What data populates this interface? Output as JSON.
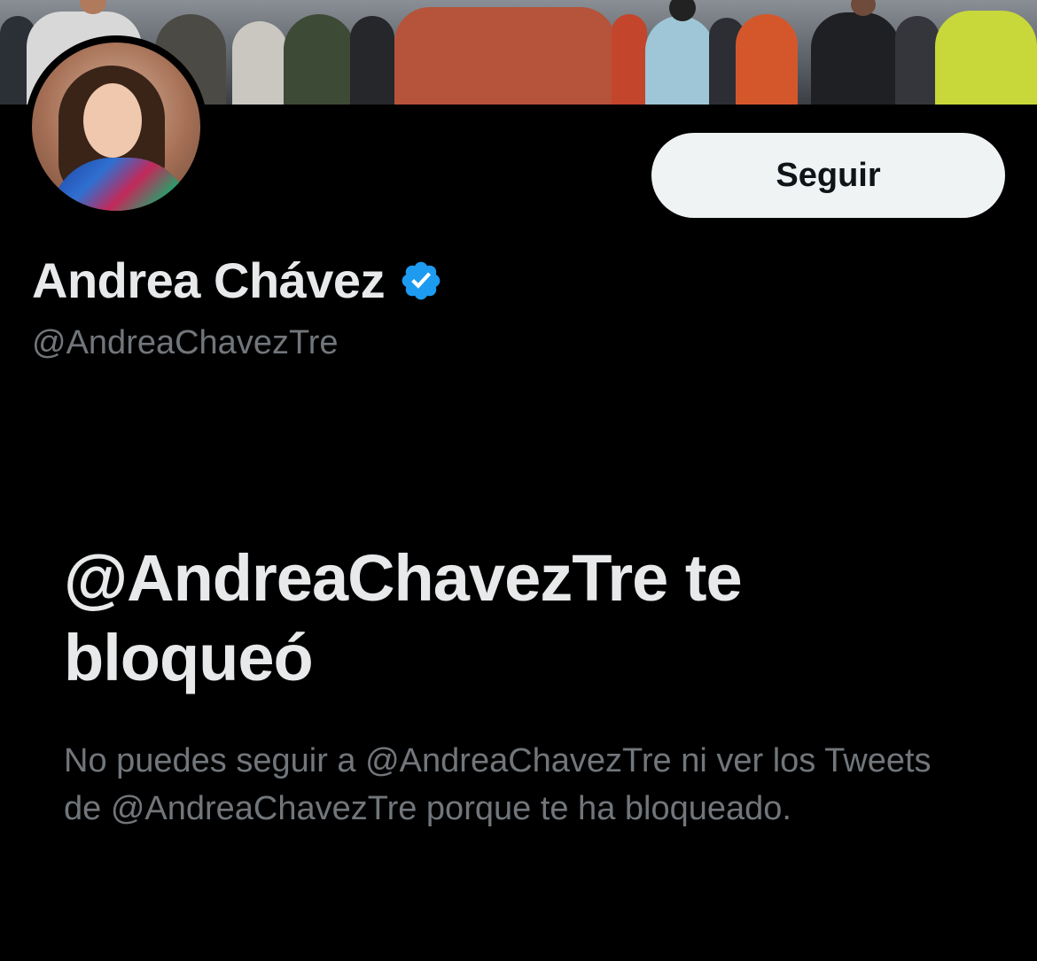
{
  "profile": {
    "follow_label": "Seguir",
    "display_name": "Andrea Chávez",
    "handle": "@AndreaChavezTre",
    "verified": true
  },
  "blocked": {
    "title": "@AndreaChavezTre te bloqueó",
    "description": "No puedes seguir a @AndreaChavezTre ni ver los Tweets de @AndreaChavezTre porque te ha bloqueado."
  },
  "icons": {
    "verified": "verified-badge-icon"
  },
  "colors": {
    "background": "#000000",
    "primary_text": "#e7e9ea",
    "secondary_text": "#71767b",
    "verified_blue": "#1d9bf0",
    "button_bg": "#eff3f4",
    "button_text": "#0f1419"
  }
}
